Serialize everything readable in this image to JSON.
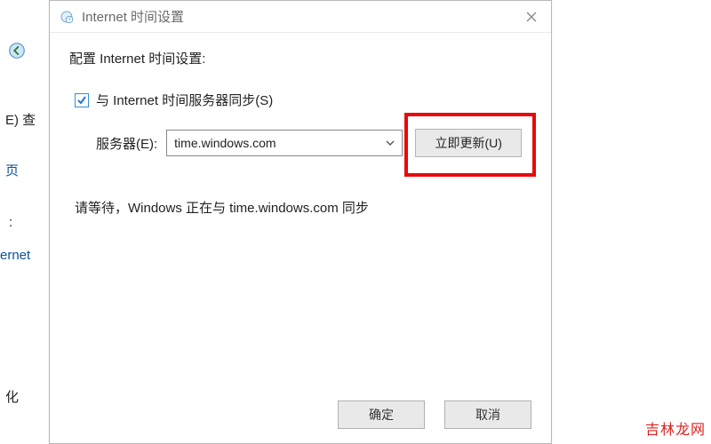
{
  "backdrop": {
    "edit_fragment": "E)  查",
    "page_fragment": "页",
    "ernet_fragment": "ernet",
    "hua_fragment": "化"
  },
  "dialog": {
    "title": "Internet 时间设置",
    "heading": "配置 Internet 时间设置:",
    "sync_checkbox_label": "与 Internet 时间服务器同步(S)",
    "sync_checked": true,
    "server_label": "服务器(E):",
    "server_value": "time.windows.com",
    "update_button": "立即更新(U)",
    "status_text": "请等待，Windows 正在与 time.windows.com 同步",
    "ok_button": "确定",
    "cancel_button": "取消"
  },
  "watermark": "吉林龙网"
}
